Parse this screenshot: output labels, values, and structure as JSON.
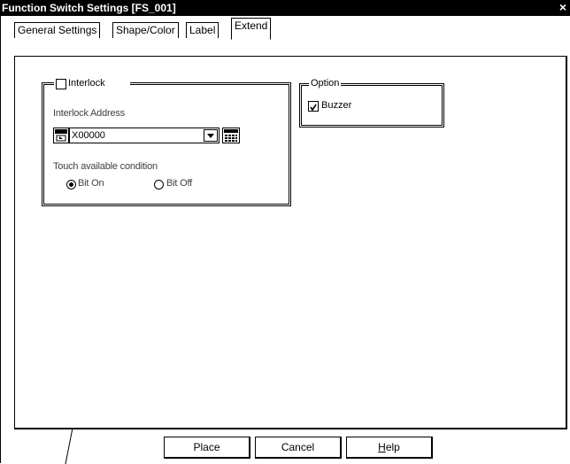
{
  "window": {
    "title": "Function Switch Settings [FS_001]",
    "close_glyph": "×"
  },
  "tabs": [
    {
      "label": "General Settings",
      "active": false
    },
    {
      "label": "Shape/Color",
      "active": false
    },
    {
      "label": "Label",
      "active": false
    },
    {
      "label": "Extend",
      "active": true
    }
  ],
  "interlock": {
    "checkbox_label": "Interlock",
    "checked": false,
    "address_label": "Interlock Address",
    "address_value": "X00000",
    "touch_condition_label": "Touch available condition",
    "options": [
      {
        "label": "Bit On",
        "selected": true
      },
      {
        "label": "Bit Off",
        "selected": false
      }
    ]
  },
  "option": {
    "group_label": "Option",
    "buzzer_label": "Buzzer",
    "buzzer_checked": true
  },
  "buttons": {
    "place": "Place",
    "cancel": "Cancel",
    "help": "Help"
  },
  "icons": {
    "device-icon": "device-selector",
    "keypad-icon": "keypad"
  }
}
